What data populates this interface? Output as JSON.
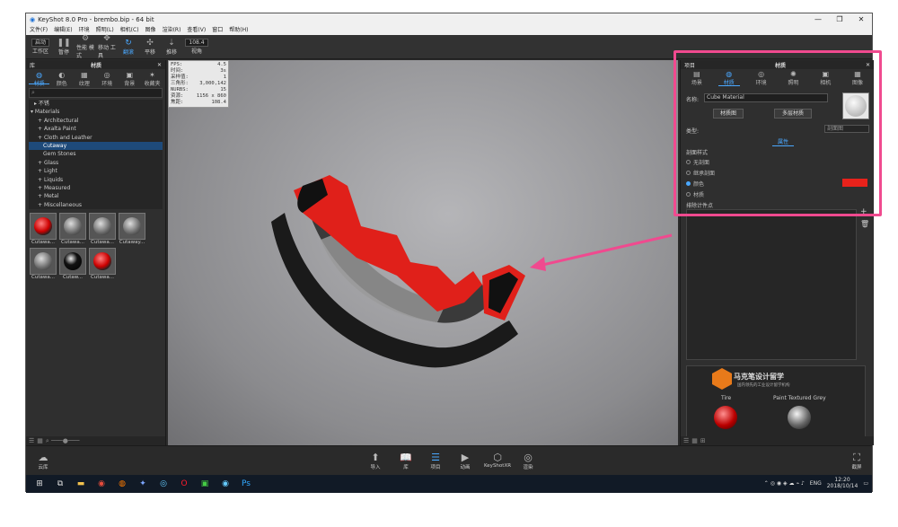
{
  "window": {
    "title": "KeyShot 8.0 Pro - brembo.bip - 64 bit",
    "controls": [
      "—",
      "❐",
      "✕"
    ]
  },
  "menu": [
    "文件(F)",
    "编辑(E)",
    "环境",
    "照明(L)",
    "相机(C)",
    "图像",
    "渲染(R)",
    "查看(V)",
    "窗口",
    "帮助(H)"
  ],
  "toolbar": {
    "mode": "启动",
    "items": [
      {
        "label": "工作区",
        "icon": "▦"
      },
      {
        "label": "暂停",
        "icon": "❚❚"
      },
      {
        "label": "性能\n模式",
        "icon": "⚙"
      },
      {
        "label": "移动\n工具",
        "icon": "✥"
      },
      {
        "label": "翻滚",
        "icon": "↻",
        "active": true
      },
      {
        "label": "平移",
        "icon": "✣"
      },
      {
        "label": "推移",
        "icon": "⇣"
      }
    ],
    "fov_value": "108.4",
    "fov_label": "视角"
  },
  "library": {
    "title": "材质",
    "panel_label": "库",
    "tabs": [
      "材质",
      "颜色",
      "纹理",
      "环境",
      "背景",
      "收藏夹"
    ],
    "search_placeholder": "",
    "tree": [
      "不锈",
      "Materials",
      "Architectural",
      "Axalta Paint",
      "Cloth and Leather",
      "Cutaway",
      "Gem Stones",
      "Glass",
      "Light",
      "Liquids",
      "Measured",
      "Metal",
      "Miscellaneous"
    ],
    "selected": "Cutaway",
    "thumbs": [
      {
        "label": "Cutawa...",
        "style": "r"
      },
      {
        "label": "Cutawa...",
        "style": "g"
      },
      {
        "label": "Cutawa...",
        "style": "g"
      },
      {
        "label": "Cutaway...",
        "style": "g"
      },
      {
        "label": "Cutawa...",
        "style": "g"
      },
      {
        "label": "Cutaw...",
        "style": "k"
      },
      {
        "label": "Cutawa...",
        "style": "r"
      },
      {
        "label": "Cutaway...",
        "style": "r"
      }
    ]
  },
  "stats": [
    [
      "FPS:",
      "4.5"
    ],
    [
      "时间:",
      "3s"
    ],
    [
      "采样值:",
      "1"
    ],
    [
      "三角形:",
      "3,000,142"
    ],
    [
      "NURBS:",
      "15"
    ],
    [
      "资源:",
      "1156 x 860"
    ],
    [
      "焦距:",
      "108.4"
    ]
  ],
  "project": {
    "panel_label": "项目",
    "title": "材质",
    "tabs": [
      "场景",
      "材质",
      "环境",
      "照明",
      "相机",
      "图像"
    ],
    "name_label": "名称:",
    "name_value": "Cube Material",
    "btn_material_graph": "材质图",
    "btn_multi": "多层材质",
    "type_label": "类型:",
    "type_value": "剖面图",
    "section": "属性",
    "style_label": "剖面样式",
    "options": [
      "无剖面",
      "继承剖面",
      "颜色",
      "材质"
    ],
    "selected_option": "颜色",
    "color": "#e8221b",
    "exclude_label": "排除计件点",
    "preview_labels": [
      "Tire",
      "Paint Textured Grey"
    ]
  },
  "bottom": {
    "items": [
      {
        "label": "导入",
        "icon": "⬆"
      },
      {
        "label": "库",
        "icon": "📖",
        "active": true
      },
      {
        "label": "项目",
        "icon": "☰",
        "active": true
      },
      {
        "label": "动画",
        "icon": "▶"
      },
      {
        "label": "KeyShotXR",
        "icon": "⬡"
      },
      {
        "label": "渲染",
        "icon": "◎"
      }
    ],
    "left_label": "云库",
    "right_label": "截屏"
  },
  "taskbar": {
    "lang": "ENG",
    "time": "12:20",
    "date": "2018/10/14"
  },
  "watermark": {
    "title": "马克笔设计留学",
    "sub": "国内领先的工业设计留学机构"
  }
}
